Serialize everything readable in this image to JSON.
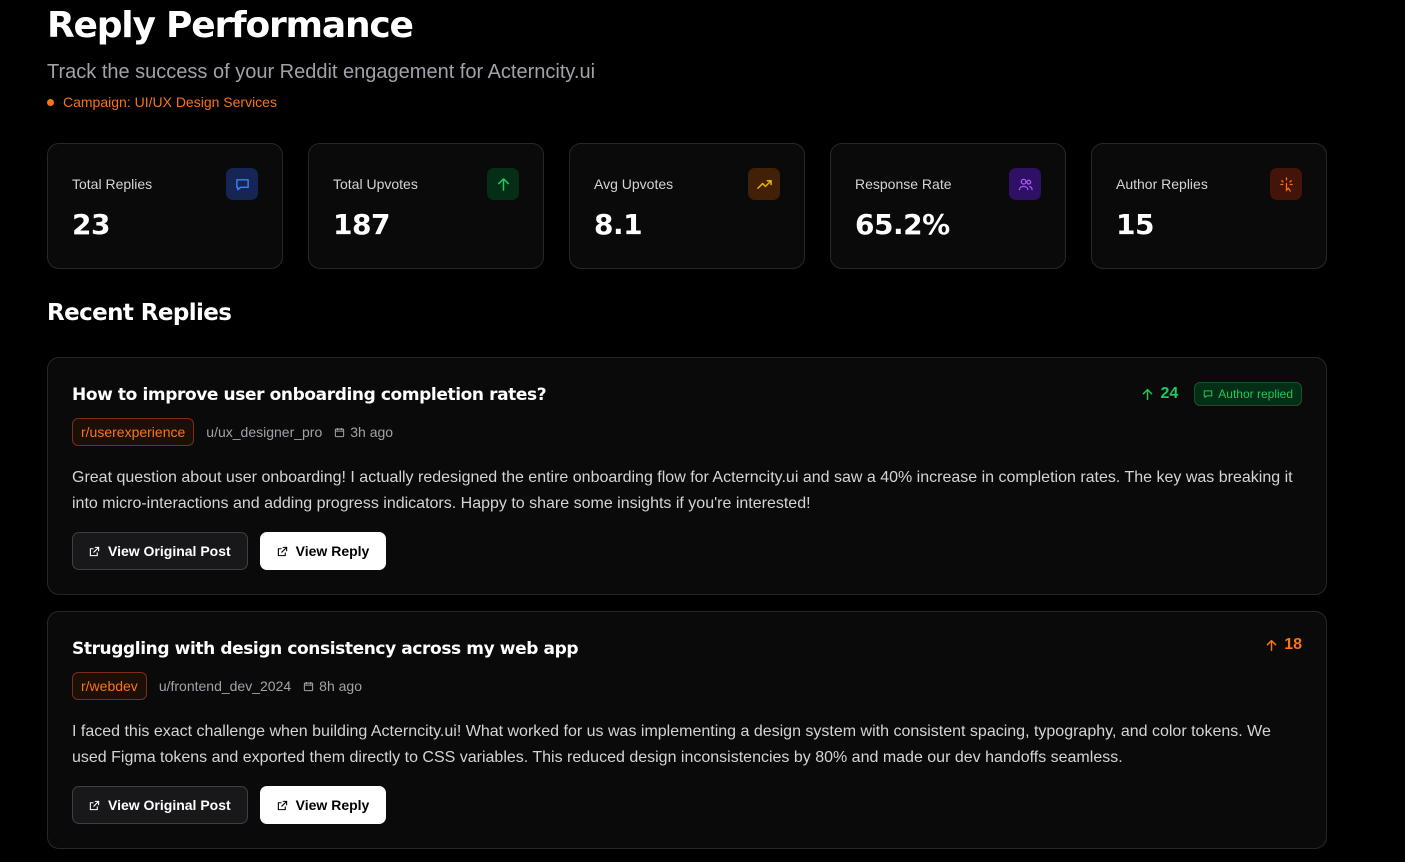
{
  "header": {
    "title": "Reply Performance",
    "subtitle": "Track the success of your Reddit engagement for Acterncity.ui",
    "campaign": "Campaign: UI/UX Design Services"
  },
  "stats": [
    {
      "label": "Total Replies",
      "value": "23",
      "icon": "message-icon",
      "color": "#3b82f6"
    },
    {
      "label": "Total Upvotes",
      "value": "187",
      "icon": "arrow-up-icon",
      "color": "#22c55e"
    },
    {
      "label": "Avg Upvotes",
      "value": "8.1",
      "icon": "trending-up-icon",
      "color": "#eab308"
    },
    {
      "label": "Response Rate",
      "value": "65.2%",
      "icon": "users-icon",
      "color": "#a855f7"
    },
    {
      "label": "Author Replies",
      "value": "15",
      "icon": "pointer-icon",
      "color": "#f97316"
    }
  ],
  "section_title": "Recent Replies",
  "replies": [
    {
      "title": "How to improve user onboarding completion rates?",
      "subreddit": "r/userexperience",
      "user": "u/ux_designer_pro",
      "time": "3h ago",
      "upvotes": "24",
      "upvote_color": "#22c55e",
      "author_replied": "Author replied",
      "body": "Great question about user onboarding! I actually redesigned the entire onboarding flow for Acterncity.ui and saw a 40% increase in completion rates. The key was breaking it into micro-interactions and adding progress indicators. Happy to share some insights if you're interested!",
      "view_original": "View Original Post",
      "view_reply": "View Reply"
    },
    {
      "title": "Struggling with design consistency across my web app",
      "subreddit": "r/webdev",
      "user": "u/frontend_dev_2024",
      "time": "8h ago",
      "upvotes": "18",
      "upvote_color": "#f97316",
      "body": "I faced this exact challenge when building Acterncity.ui! What worked for us was implementing a design system with consistent spacing, typography, and color tokens. We used Figma tokens and exported them directly to CSS variables. This reduced design inconsistencies by 80% and made our dev handoffs seamless.",
      "view_original": "View Original Post",
      "view_reply": "View Reply"
    }
  ]
}
